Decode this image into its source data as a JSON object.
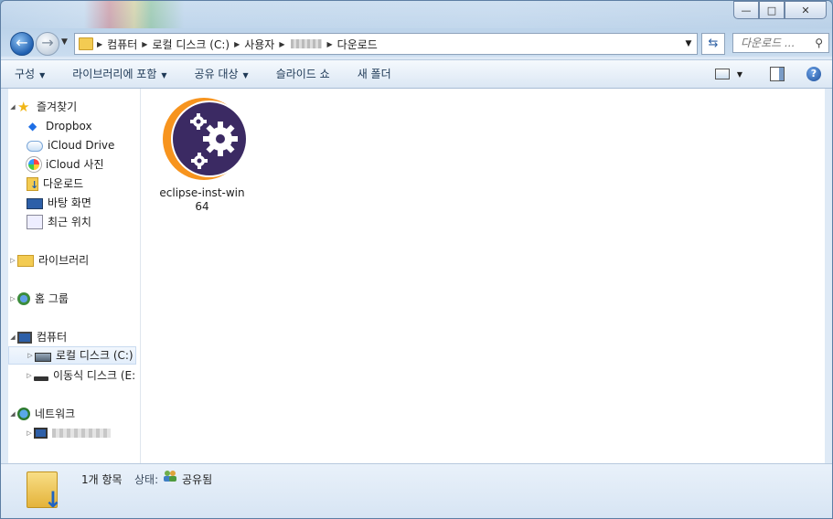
{
  "window": {
    "caption_buttons": {
      "minimize": "—",
      "maximize": "□",
      "close": "✕"
    }
  },
  "address": {
    "crumbs": [
      "컴퓨터",
      "로컬 디스크 (C:)",
      "사용자",
      "다운로드"
    ],
    "search_placeholder": "다운로드 ..."
  },
  "toolbar": {
    "organize": "구성",
    "include_library": "라이브러리에 포함",
    "share_with": "공유 대상",
    "slideshow": "슬라이드 쇼",
    "new_folder": "새 폴더",
    "help": "?"
  },
  "nav": {
    "favorites": "즐겨찾기",
    "dropbox": "Dropbox",
    "icloud_drive": "iCloud Drive",
    "icloud_photos": "iCloud 사진",
    "downloads": "다운로드",
    "desktop": "바탕 화면",
    "recent": "최근 위치",
    "libraries": "라이브러리",
    "homegroup": "홈 그룹",
    "computer": "컴퓨터",
    "local_disk": "로컬 디스크 (C:)",
    "removable_disk": "이동식 디스크 (E:",
    "network": "네트워크"
  },
  "files": [
    {
      "name": "eclipse-inst-win64",
      "icon": "eclipse-installer-icon"
    }
  ],
  "status": {
    "count": "1개 항목",
    "state_label": "상태:",
    "state_value": "공유됨"
  },
  "colors": {
    "eclipse_purple": "#3b2a63",
    "eclipse_orange": "#f7941e"
  }
}
